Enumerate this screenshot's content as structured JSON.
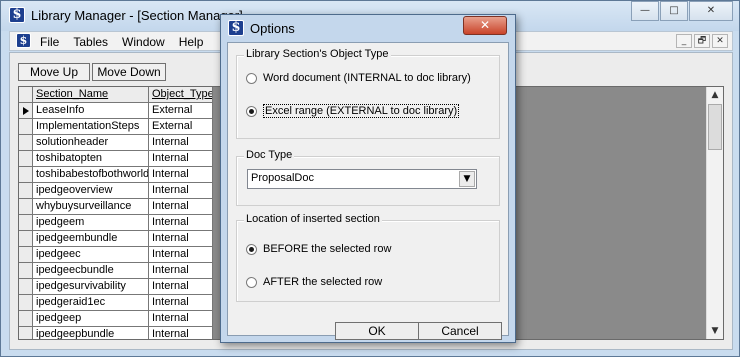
{
  "main_window": {
    "title": "Library Manager - [Section Manager]",
    "controls": [
      "—",
      "□",
      "✕"
    ]
  },
  "menubar": {
    "items": [
      "File",
      "Tables",
      "Window",
      "Help"
    ],
    "child_controls": [
      "_",
      "🗗",
      "✕"
    ]
  },
  "toolbar": {
    "move_up_label": "Move Up",
    "move_down_label": "Move Down"
  },
  "grid": {
    "columns": [
      "Section_Name",
      "Object_Type"
    ],
    "rows": [
      {
        "name": "LeaseInfo",
        "type": "External",
        "selected": true
      },
      {
        "name": "ImplementationSteps",
        "type": "External"
      },
      {
        "name": "solutionheader",
        "type": "Internal"
      },
      {
        "name": "toshibatopten",
        "type": "Internal"
      },
      {
        "name": "toshibabestofbothworlds",
        "type": "Internal"
      },
      {
        "name": "ipedgeoverview",
        "type": "Internal"
      },
      {
        "name": "whybuysurveillance",
        "type": "Internal"
      },
      {
        "name": "ipedgeem",
        "type": "Internal"
      },
      {
        "name": "ipedgeembundle",
        "type": "Internal"
      },
      {
        "name": "ipedgeec",
        "type": "Internal"
      },
      {
        "name": "ipedgeecbundle",
        "type": "Internal"
      },
      {
        "name": "ipedgesurvivability",
        "type": "Internal"
      },
      {
        "name": "ipedgeraid1ec",
        "type": "Internal"
      },
      {
        "name": "ipedgeep",
        "type": "Internal"
      },
      {
        "name": "ipedgeepbundle",
        "type": "Internal"
      }
    ],
    "scroll_up": "▲",
    "scroll_down": "▼"
  },
  "dialog": {
    "title": "Options",
    "close": "✕",
    "object_type_group": {
      "label": "Library Section's Object Type",
      "option_word": "Word document (INTERNAL to doc library)",
      "option_excel": "Excel range (EXTERNAL to doc library)",
      "selected": "excel"
    },
    "doc_type_group": {
      "label": "Doc Type",
      "value": "ProposalDoc",
      "arrow": "▼"
    },
    "location_group": {
      "label": "Location of inserted section",
      "option_before": "BEFORE the selected row",
      "option_after": "AFTER the selected row",
      "selected": "before"
    },
    "ok_label": "OK",
    "cancel_label": "Cancel"
  }
}
